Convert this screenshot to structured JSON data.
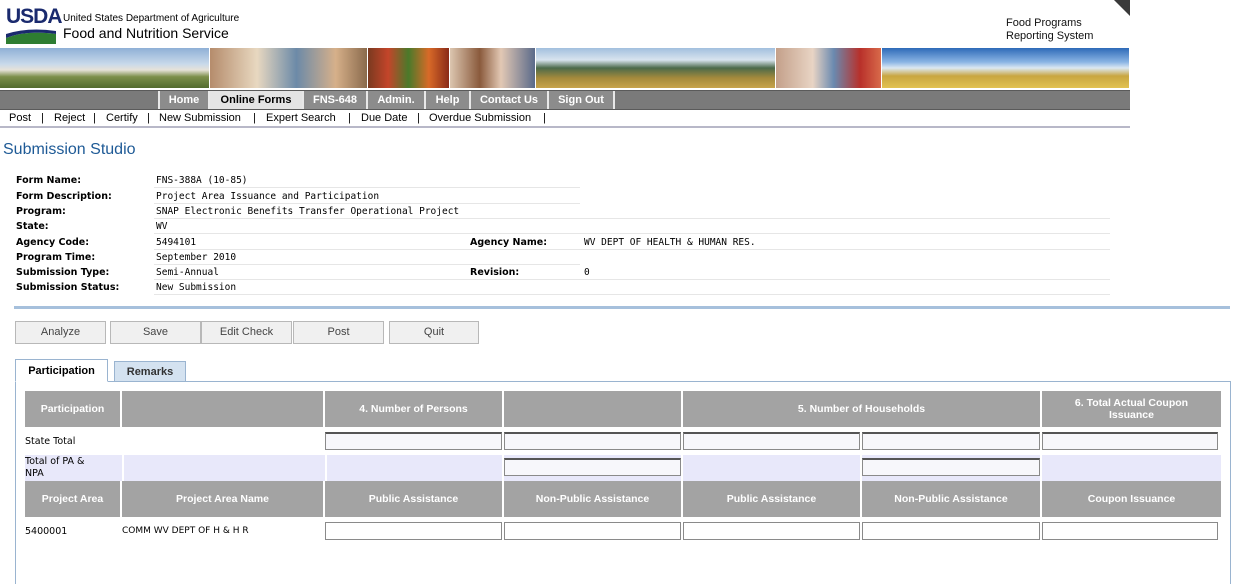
{
  "header": {
    "logo_text": "USDA",
    "agency_line1": "United States Department of Agriculture",
    "agency_line2": "Food and Nutrition Service",
    "system_line1": "Food Programs",
    "system_line2": "Reporting System"
  },
  "nav": {
    "items": [
      {
        "label": "Home",
        "active": false
      },
      {
        "label": "Online Forms",
        "active": true
      },
      {
        "label": "FNS-648",
        "active": false
      },
      {
        "label": "Admin.",
        "active": false
      },
      {
        "label": "Help",
        "active": false
      },
      {
        "label": "Contact Us",
        "active": false
      },
      {
        "label": "Sign Out",
        "active": false
      }
    ]
  },
  "subnav": {
    "items": [
      "Post",
      "Reject",
      "Certify",
      "New Submission",
      "Expert Search",
      "Due Date",
      "Overdue Submission"
    ],
    "separator": "|"
  },
  "studio": {
    "title": "Submission Studio",
    "form_name_label": "Form Name:",
    "form_name": "FNS-388A (10-85)",
    "form_description_label": "Form Description:",
    "form_description": "Project Area Issuance and Participation",
    "program_label": "Program:",
    "program": "SNAP Electronic Benefits Transfer Operational Project",
    "state_label": "State:",
    "state": "WV",
    "agency_code_label": "Agency Code:",
    "agency_code": "5494101",
    "agency_name_label": "Agency Name:",
    "agency_name": "WV DEPT OF HEALTH & HUMAN RES.",
    "program_time_label": "Program Time:",
    "program_time": "September 2010",
    "submission_type_label": "Submission Type:",
    "submission_type": "Semi-Annual",
    "revision_label": "Revision:",
    "revision": "0",
    "submission_status_label": "Submission Status:",
    "submission_status": "New Submission"
  },
  "actions": {
    "analyze": "Analyze",
    "save": "Save",
    "edit_check": "Edit Check",
    "post": "Post",
    "quit": "Quit"
  },
  "tabs": {
    "participation": "Participation",
    "remarks": "Remarks"
  },
  "grid": {
    "header1": {
      "participation": "Participation",
      "persons": "4. Number of Persons",
      "households": "5. Number of Households",
      "coupon": "6. Total Actual Coupon Issuance"
    },
    "state_total": "State Total",
    "total_pa_npa": "Total of PA & NPA",
    "header2": {
      "project_area": "Project Area",
      "project_area_name": "Project Area Name",
      "pa1": "Public Assistance",
      "npa1": "Non-Public Assistance",
      "pa2": "Public Assistance",
      "npa2": "Non-Public Assistance",
      "coupon_issuance": "Coupon Issuance"
    },
    "rows": [
      {
        "project_area": "5400001",
        "name": "COMM WV DEPT OF H & H R"
      }
    ]
  }
}
